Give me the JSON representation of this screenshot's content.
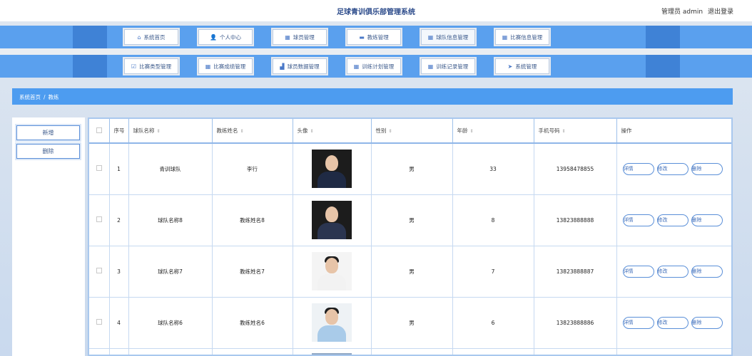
{
  "header": {
    "title": "足球青训俱乐部管理系统",
    "user_label": "管理员 admin",
    "logout_label": "退出登录"
  },
  "nav_row1": [
    {
      "label": "系统首页",
      "icon": "home-icon",
      "glyph": "⌂"
    },
    {
      "label": "个人中心",
      "icon": "user-icon",
      "glyph": "👤"
    },
    {
      "label": "球员管理",
      "icon": "grid-icon",
      "glyph": "▦"
    },
    {
      "label": "教练管理",
      "icon": "briefcase-icon",
      "glyph": "▬"
    },
    {
      "label": "球队信息管理",
      "icon": "grid-icon",
      "glyph": "▦"
    },
    {
      "label": "比赛信息管理",
      "icon": "grid-icon",
      "glyph": "▦"
    }
  ],
  "nav_row2": [
    {
      "label": "比赛类型管理",
      "icon": "checkbox-icon",
      "glyph": "☑"
    },
    {
      "label": "比赛成绩管理",
      "icon": "grid-icon",
      "glyph": "▦"
    },
    {
      "label": "球员数据管理",
      "icon": "chart-icon",
      "glyph": "▟"
    },
    {
      "label": "训练计划管理",
      "icon": "grid-icon",
      "glyph": "▦"
    },
    {
      "label": "训练记录管理",
      "icon": "grid-icon",
      "glyph": "▦"
    },
    {
      "label": "系统管理",
      "icon": "send-icon",
      "glyph": "➤"
    }
  ],
  "breadcrumb": {
    "home": "系统首页",
    "sep": "/",
    "current": "教练"
  },
  "side_actions": {
    "add_label": "新增",
    "delete_label": "删除"
  },
  "table": {
    "headers": [
      "序号",
      "球队名称",
      "教练姓名",
      "头像",
      "性别",
      "年龄",
      "手机号码",
      "操作"
    ],
    "rows": [
      {
        "index": "1",
        "team": "青训球队",
        "coach": "李行",
        "gender": "男",
        "age": "33",
        "phone": "13958478855",
        "avatar_color": "#1f2a44"
      },
      {
        "index": "2",
        "team": "球队名称8",
        "coach": "教练姓名8",
        "gender": "男",
        "age": "8",
        "phone": "13823888888",
        "avatar_color": "#2b3550"
      },
      {
        "index": "3",
        "team": "球队名称7",
        "coach": "教练姓名7",
        "gender": "男",
        "age": "7",
        "phone": "13823888887",
        "avatar_color": "#f2f2f2"
      },
      {
        "index": "4",
        "team": "球队名称6",
        "coach": "教练姓名6",
        "gender": "男",
        "age": "6",
        "phone": "13823888886",
        "avatar_color": "#a9cbe9"
      }
    ],
    "actions": {
      "detail": "详情",
      "edit": "修改",
      "delete": "删除"
    }
  }
}
